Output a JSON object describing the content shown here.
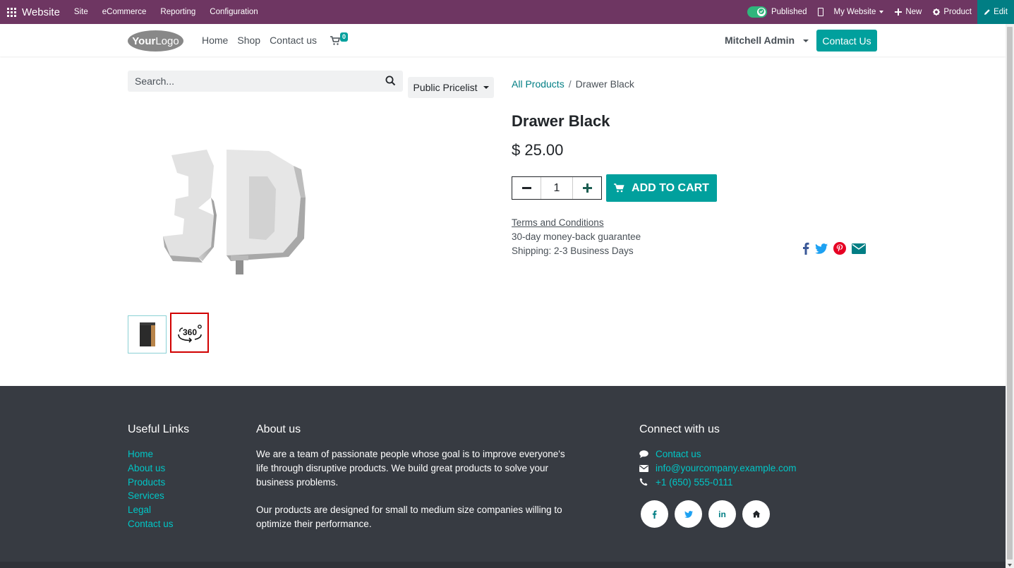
{
  "adminbar": {
    "brand": "Website",
    "menus": [
      "Site",
      "eCommerce",
      "Reporting",
      "Configuration"
    ],
    "published": "Published",
    "my_website": "My Website",
    "new": "New",
    "product": "Product",
    "edit": "Edit",
    "color": "#6e3662"
  },
  "header": {
    "logo_bold": "Your",
    "logo_rest": "Logo",
    "nav": [
      "Home",
      "Shop",
      "Contact us"
    ],
    "cart_count": "0",
    "user": "Mitchell Admin",
    "contact_button": "Contact Us"
  },
  "shop": {
    "search_placeholder": "Search...",
    "pricelist": "Public Pricelist",
    "breadcrumb_root": "All Products",
    "breadcrumb_sep": "/",
    "breadcrumb_current": "Drawer Black"
  },
  "product": {
    "name": "Drawer Black",
    "price": "$ 25.00",
    "quantity": "1",
    "add_to_cart": "ADD TO CART",
    "terms": "Terms and Conditions",
    "guarantee": "30-day money-back guarantee",
    "shipping": "Shipping: 2-3 Business Days",
    "accent": "#01a09d",
    "thumb_360_label": "360"
  },
  "footer": {
    "useful_links_title": "Useful Links",
    "useful_links": [
      "Home",
      "About us",
      "Products",
      "Services",
      "Legal",
      "Contact us"
    ],
    "about_title": "About us",
    "about_p1": "We are a team of passionate people whose goal is to improve everyone's life through disruptive products. We build great products to solve your business problems.",
    "about_p2": "Our products are designed for small to medium size companies willing to optimize their performance.",
    "connect_title": "Connect with us",
    "connect_contact": "Contact us",
    "connect_email": "info@yourcompany.example.com",
    "connect_phone": "+1 (650) 555-0111",
    "social_linkedin": "in",
    "bg": "#373b42",
    "link_color": "#00c6c6"
  }
}
